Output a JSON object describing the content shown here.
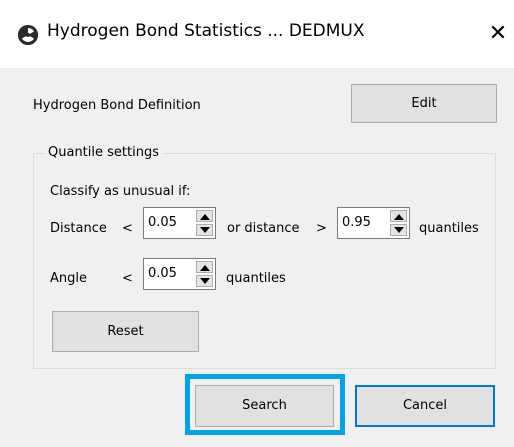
{
  "window": {
    "title": "Hydrogen Bond Statistics ... DEDMUX",
    "close_glyph": "✕",
    "app_icon": "radiation-icon"
  },
  "definition": {
    "label": "Hydrogen Bond Definition",
    "edit_label": "Edit"
  },
  "quantile": {
    "group_title": "Quantile settings",
    "classify_label": "Classify as unusual if:",
    "distance_label": "Distance",
    "lt1": "<",
    "distance_low": "0.05",
    "or_distance_label": "or distance",
    "gt": ">",
    "distance_high": "0.95",
    "quantiles_label_1": "quantiles",
    "angle_label": "Angle",
    "lt2": "<",
    "angle_low": "0.05",
    "quantiles_label_2": "quantiles",
    "reset_label": "Reset"
  },
  "footer": {
    "search_label": "Search",
    "cancel_label": "Cancel"
  },
  "colors": {
    "highlight": "#00a2e8",
    "default_button_border": "#0078d7",
    "window_bg": "#f0f0f0"
  }
}
